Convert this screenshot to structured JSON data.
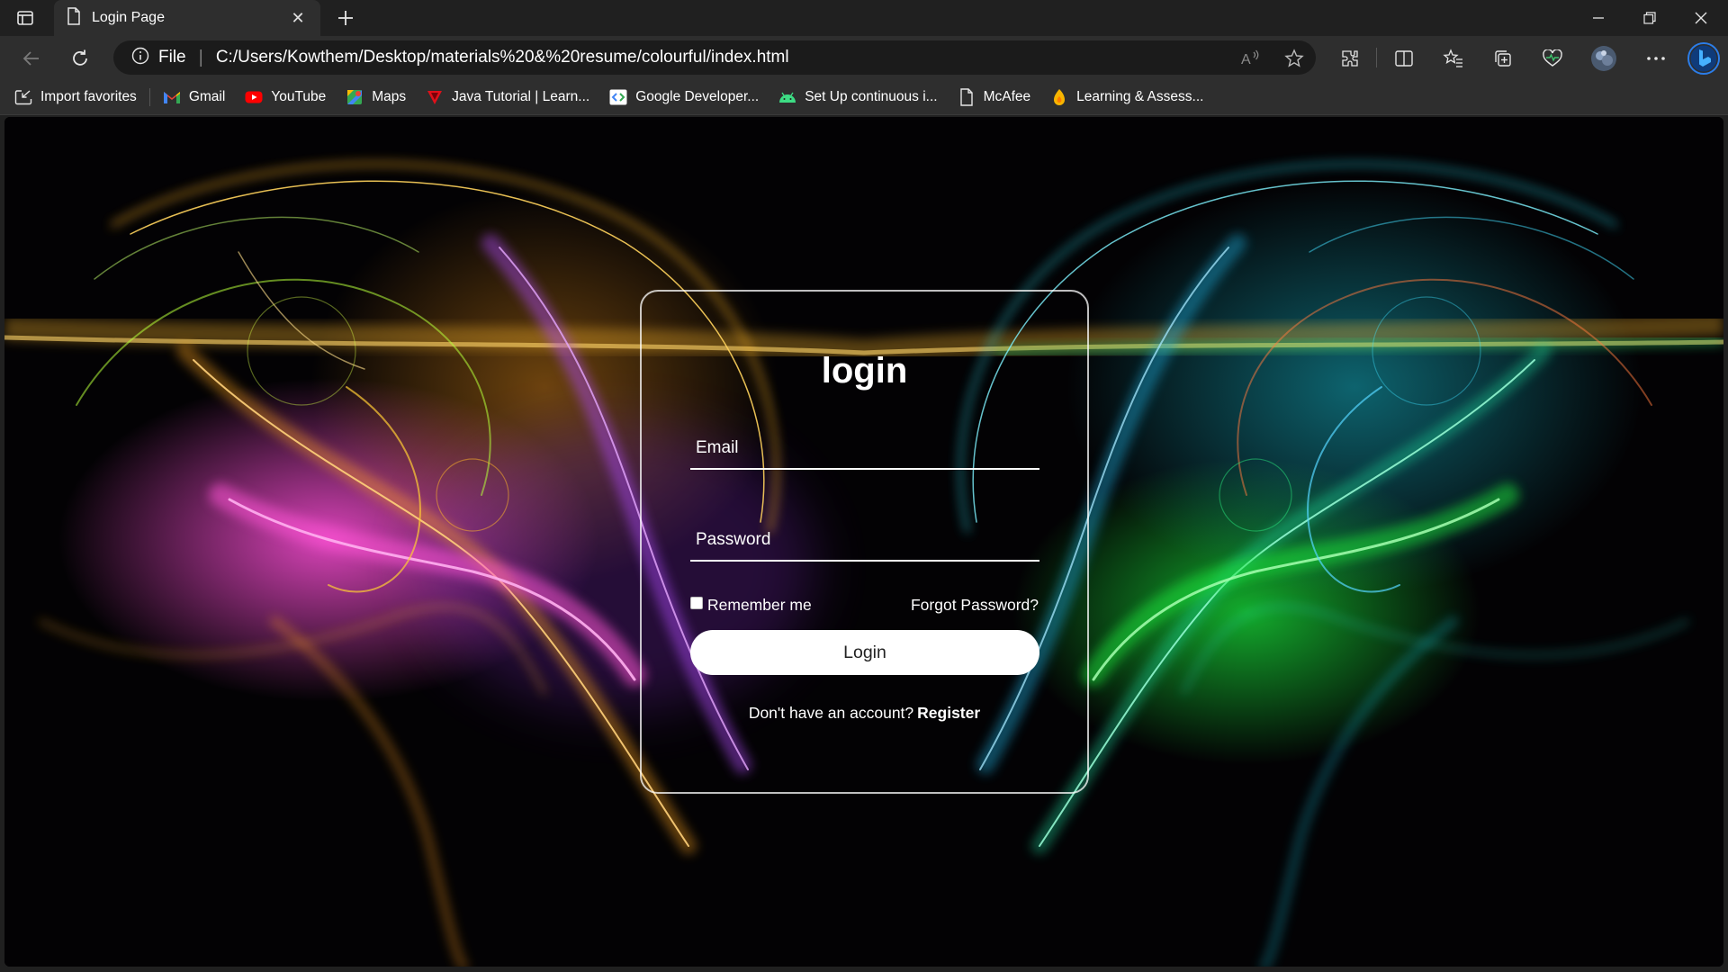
{
  "browser": {
    "tab_title": "Login Page",
    "omnibox": {
      "scheme_label": "File",
      "url": "C:/Users/Kowthem/Desktop/materials%20&%20resume/colourful/index.html"
    },
    "bookmarks": [
      {
        "label": "Import favorites",
        "icon": "import-icon"
      },
      {
        "label": "Gmail",
        "icon": "gmail-icon"
      },
      {
        "label": "YouTube",
        "icon": "youtube-icon"
      },
      {
        "label": "Maps",
        "icon": "maps-icon"
      },
      {
        "label": "Java Tutorial | Learn...",
        "icon": "java-tutorial-icon"
      },
      {
        "label": "Google Developer...",
        "icon": "google-developers-icon"
      },
      {
        "label": "Set Up continuous i...",
        "icon": "android-icon"
      },
      {
        "label": "McAfee",
        "icon": "page-icon"
      },
      {
        "label": "Learning & Assess...",
        "icon": "learning-icon"
      }
    ],
    "colors": {
      "chrome_bg": "#202020",
      "toolbar_bg": "#2e2e2e",
      "omnibox_bg": "#1b1b1b",
      "copilot_blue": "#1a73e8"
    }
  },
  "login": {
    "title": "login",
    "email_placeholder": "Email",
    "password_placeholder": "Password",
    "remember_label": "Remember me",
    "forgot_label": "Forgot Password?",
    "login_button": "Login",
    "register_prompt": "Don't have an account?",
    "register_link": "Register"
  }
}
